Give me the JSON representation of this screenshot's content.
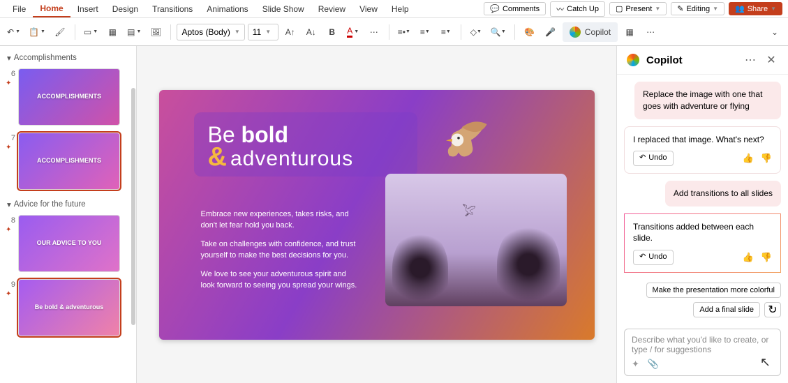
{
  "menu": {
    "items": [
      "File",
      "Home",
      "Insert",
      "Design",
      "Transitions",
      "Animations",
      "Slide Show",
      "Review",
      "View",
      "Help"
    ],
    "active_index": 1
  },
  "menubar_right": {
    "comments": "Comments",
    "catchup": "Catch Up",
    "present": "Present",
    "editing": "Editing",
    "share": "Share"
  },
  "toolbar": {
    "font_name": "Aptos (Body)",
    "font_size": "11",
    "copilot_label": "Copilot"
  },
  "sections": [
    {
      "title": "Accomplishments"
    },
    {
      "title": "Advice for the future"
    }
  ],
  "thumbs": [
    {
      "num": "6",
      "label": "ACCOMPLISHMENTS"
    },
    {
      "num": "7",
      "label": "ACCOMPLISHMENTS"
    },
    {
      "num": "8",
      "label": "OUR ADVICE TO YOU"
    },
    {
      "num": "9",
      "label": "Be bold & adventurous"
    }
  ],
  "slide": {
    "title_prefix": "Be ",
    "title_bold": "bold",
    "title_sub": "adventurous",
    "body": [
      "Embrace new experiences, takes risks, and don't let fear hold you back.",
      "Take on challenges with confidence, and trust yourself to make the best decisions for you.",
      "We love to see your adventurous spirit and look forward to seeing you spread your wings."
    ]
  },
  "copilot": {
    "title": "Copilot",
    "messages": [
      {
        "role": "user",
        "text": "Replace the image with one that goes with adventure or flying"
      },
      {
        "role": "assistant",
        "text": "I replaced that image. What's next?",
        "undo": "Undo"
      },
      {
        "role": "user",
        "text": "Add transitions to all slides"
      },
      {
        "role": "assistant",
        "text": "Transitions added between each slide.",
        "undo": "Undo",
        "highlight": true
      }
    ],
    "suggestions": [
      "Make the presentation more colorful",
      "Add a final slide"
    ],
    "placeholder": "Describe what you'd like to create, or type / for suggestions"
  }
}
